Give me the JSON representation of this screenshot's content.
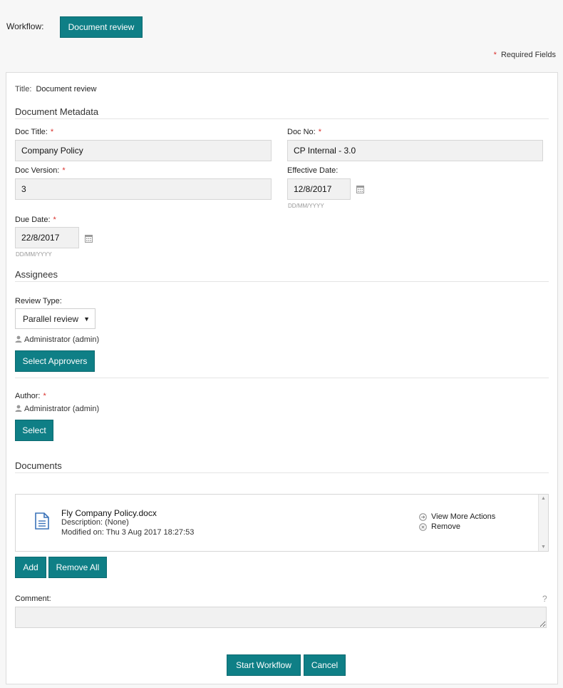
{
  "header": {
    "workflow_label": "Workflow:",
    "workflow_button": "Document review",
    "required_star": "*",
    "required_text": "Required Fields"
  },
  "form": {
    "title_label": "Title:",
    "title_value": "Document review",
    "metadata_heading": "Document Metadata",
    "doc_title_label": "Doc Title:",
    "doc_title_value": "Company Policy",
    "doc_no_label": "Doc No:",
    "doc_no_value": "CP Internal - 3.0",
    "doc_version_label": "Doc Version:",
    "doc_version_value": "3",
    "effective_date_label": "Effective Date:",
    "effective_date_value": "12/8/2017",
    "effective_date_hint": "DD/MM/YYYY",
    "due_date_label": "Due Date:",
    "due_date_value": "22/8/2017",
    "due_date_hint": "DD/MM/YYYY",
    "required_star": "*"
  },
  "assignees": {
    "heading": "Assignees",
    "review_type_label": "Review Type:",
    "review_type_value": "Parallel review",
    "approver": "Administrator (admin)",
    "select_approvers_button": "Select Approvers",
    "author_label": "Author:",
    "author_value": "Administrator (admin)",
    "select_button": "Select"
  },
  "documents": {
    "heading": "Documents",
    "items": [
      {
        "name": "Fly Company Policy.docx",
        "description": "Description: (None)",
        "modified": "Modified on: Thu 3 Aug 2017 18:27:53",
        "view_more_actions": "View More Actions",
        "remove": "Remove"
      }
    ],
    "add_button": "Add",
    "remove_all_button": "Remove All"
  },
  "comment": {
    "label": "Comment:",
    "help": "?",
    "value": ""
  },
  "footer": {
    "start_button": "Start Workflow",
    "cancel_button": "Cancel"
  },
  "colors": {
    "accent": "#0f7f86",
    "required": "#d9302c",
    "doc_icon": "#3b73b9"
  }
}
